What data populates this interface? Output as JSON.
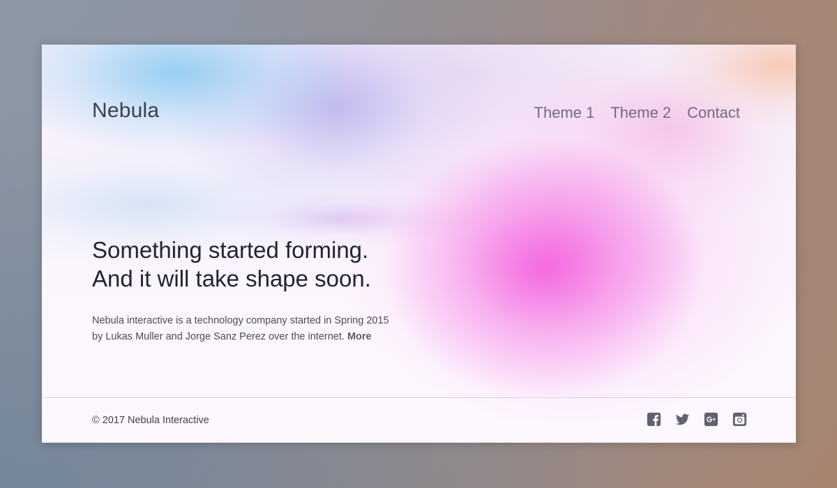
{
  "site": {
    "brand": "Nebula",
    "nav": [
      {
        "label": "Theme 1"
      },
      {
        "label": "Theme 2"
      },
      {
        "label": "Contact"
      }
    ]
  },
  "hero": {
    "headline_line1": "Something started forming.",
    "headline_line2": "And it will take shape soon.",
    "intro": "Nebula interactive is a technology company started in Spring 2015 by Lukas Muller and Jorge Sanz Perez over the internet.",
    "more_label": "More"
  },
  "footer": {
    "copyright": "© 2017 Nebula Interactive",
    "social_icons": [
      "facebook-icon",
      "twitter-icon",
      "google-plus-icon",
      "instagram-icon"
    ]
  },
  "colors": {
    "icon": "#5f6170",
    "text_dark": "#222430",
    "nav_text": "#6f6c80"
  }
}
